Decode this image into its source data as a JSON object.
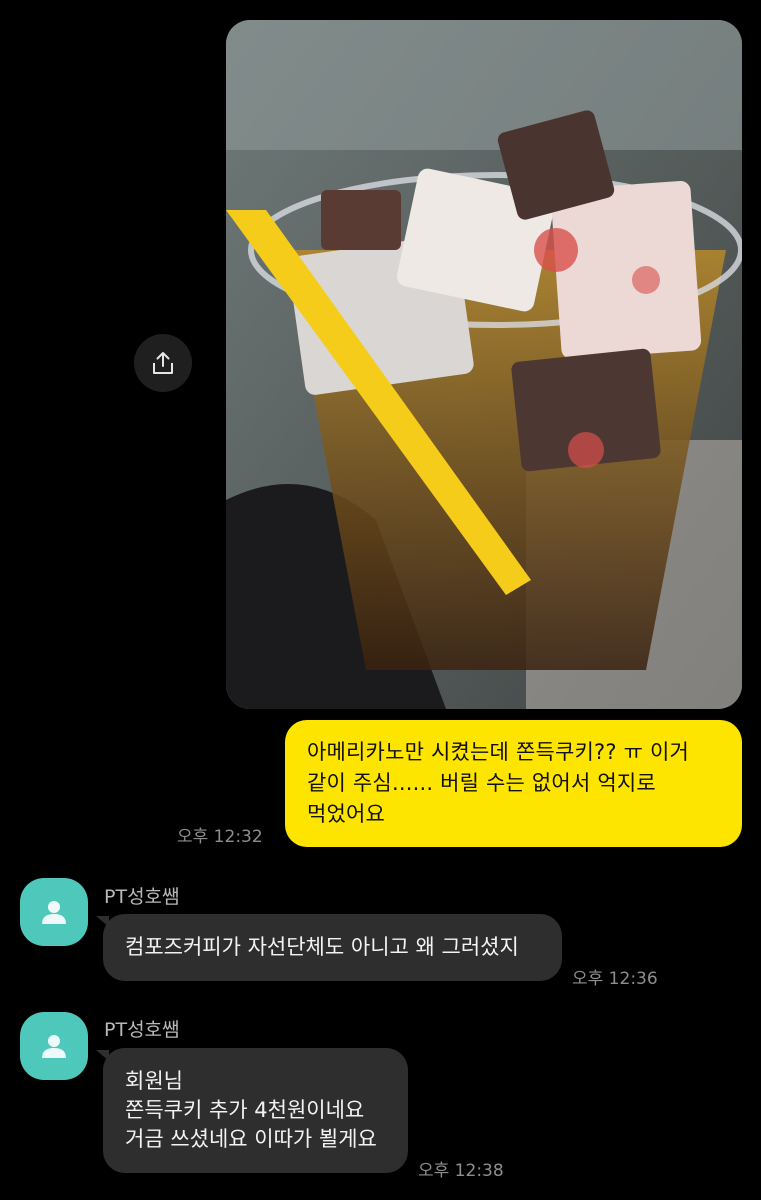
{
  "chat": {
    "photo": {
      "icon": "drink-photo",
      "description_icon": "share-icon"
    },
    "outgoing": {
      "lines": [
        "아메리카노만 시켰는데 쫀득쿠키?? ㅠ 이거",
        "같이 주심...... 버릴 수는 없어서 억지로",
        "먹었어요"
      ],
      "time": "오후 12:32"
    },
    "messages": [
      {
        "sender": "PT성호쌤",
        "lines": [
          "컴포즈커피가 자선단체도 아니고 왜 그러셨지"
        ],
        "time": "오후 12:36"
      },
      {
        "sender": "PT성호쌤",
        "lines": [
          "회원님",
          "쫀득쿠키 추가 4천원이네요",
          "거금 쓰셨네요 이따가 뵐게요"
        ],
        "time": "오후 12:38"
      }
    ]
  },
  "colors": {
    "background": "#000000",
    "my_bubble": "#fee500",
    "other_bubble": "#2e2e2e",
    "avatar": "#4fc8bc"
  }
}
